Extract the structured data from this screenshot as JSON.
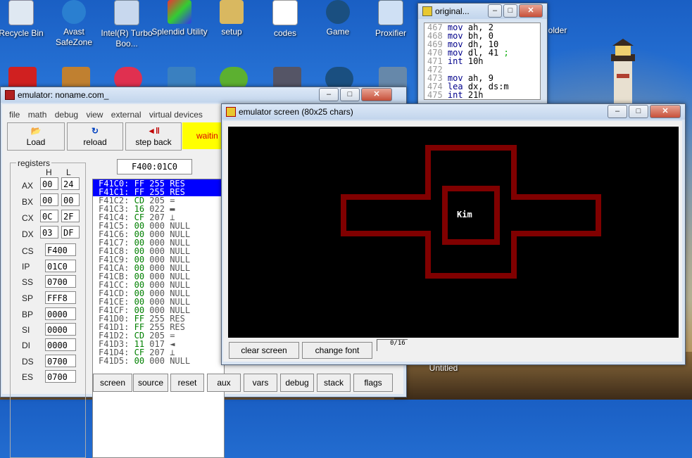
{
  "desktop": {
    "icons": [
      {
        "label": "Recycle Bin"
      },
      {
        "label": "Avast SafeZone"
      },
      {
        "label": "Intel(R) Turbo Boo..."
      },
      {
        "label": "Splendid Utility"
      },
      {
        "label": "setup"
      },
      {
        "label": "codes"
      },
      {
        "label": "Game"
      },
      {
        "label": "Proxifier"
      }
    ],
    "partial_label": "older",
    "untitled_label": "Untitled"
  },
  "source_window": {
    "title": "original...",
    "lines": [
      {
        "n": "467",
        "op": "mov",
        "args": "ah, 2",
        "comment": ""
      },
      {
        "n": "468",
        "op": "mov",
        "args": "bh, 0",
        "comment": ""
      },
      {
        "n": "469",
        "op": "mov",
        "args": "dh, 10",
        "comment": ""
      },
      {
        "n": "470",
        "op": "mov",
        "args": "dl, 41",
        "comment": ";"
      },
      {
        "n": "471",
        "op": "int",
        "args": "10h",
        "comment": ""
      },
      {
        "n": "472",
        "op": "",
        "args": "",
        "comment": ""
      },
      {
        "n": "473",
        "op": "mov",
        "args": "ah, 9",
        "comment": ""
      },
      {
        "n": "474",
        "op": "lea",
        "args": "dx, ds:m",
        "comment": ""
      },
      {
        "n": "475",
        "op": "int",
        "args": "21h",
        "comment": ""
      }
    ]
  },
  "emulator": {
    "title": "emulator: noname.com_",
    "menu": [
      "file",
      "math",
      "debug",
      "view",
      "external",
      "virtual devices"
    ],
    "toolbar": {
      "load": "Load",
      "reload": "reload",
      "step_back": "step back",
      "status": "waitin"
    },
    "registers_label": "registers",
    "h_label": "H",
    "l_label": "L",
    "regs8": [
      {
        "name": "AX",
        "h": "00",
        "l": "24"
      },
      {
        "name": "BX",
        "h": "00",
        "l": "00"
      },
      {
        "name": "CX",
        "h": "0C",
        "l": "2F"
      },
      {
        "name": "DX",
        "h": "03",
        "l": "DF"
      }
    ],
    "regs16": [
      {
        "name": "CS",
        "v": "F400"
      },
      {
        "name": "IP",
        "v": "01C0"
      },
      {
        "name": "SS",
        "v": "0700"
      },
      {
        "name": "SP",
        "v": "FFF8"
      },
      {
        "name": "BP",
        "v": "0000"
      },
      {
        "name": "SI",
        "v": "0000"
      },
      {
        "name": "DI",
        "v": "0000"
      },
      {
        "name": "DS",
        "v": "0700"
      },
      {
        "name": "ES",
        "v": "0700"
      }
    ],
    "address": "F400:01C0",
    "memory": [
      {
        "addr": "F41C0:",
        "hex": "FF",
        "dec": "255",
        "ch": "RES",
        "sel": true
      },
      {
        "addr": "F41C1:",
        "hex": "FF",
        "dec": "255",
        "ch": "RES",
        "sel": true
      },
      {
        "addr": "F41C2:",
        "hex": "CD",
        "dec": "205",
        "ch": "="
      },
      {
        "addr": "F41C3:",
        "hex": "16",
        "dec": "022",
        "ch": "▬"
      },
      {
        "addr": "F41C4:",
        "hex": "CF",
        "dec": "207",
        "ch": "⊥"
      },
      {
        "addr": "F41C5:",
        "hex": "00",
        "dec": "000",
        "ch": "NULL"
      },
      {
        "addr": "F41C6:",
        "hex": "00",
        "dec": "000",
        "ch": "NULL"
      },
      {
        "addr": "F41C7:",
        "hex": "00",
        "dec": "000",
        "ch": "NULL"
      },
      {
        "addr": "F41C8:",
        "hex": "00",
        "dec": "000",
        "ch": "NULL"
      },
      {
        "addr": "F41C9:",
        "hex": "00",
        "dec": "000",
        "ch": "NULL"
      },
      {
        "addr": "F41CA:",
        "hex": "00",
        "dec": "000",
        "ch": "NULL"
      },
      {
        "addr": "F41CB:",
        "hex": "00",
        "dec": "000",
        "ch": "NULL"
      },
      {
        "addr": "F41CC:",
        "hex": "00",
        "dec": "000",
        "ch": "NULL"
      },
      {
        "addr": "F41CD:",
        "hex": "00",
        "dec": "000",
        "ch": "NULL"
      },
      {
        "addr": "F41CE:",
        "hex": "00",
        "dec": "000",
        "ch": "NULL"
      },
      {
        "addr": "F41CF:",
        "hex": "00",
        "dec": "000",
        "ch": "NULL"
      },
      {
        "addr": "F41D0:",
        "hex": "FF",
        "dec": "255",
        "ch": "RES"
      },
      {
        "addr": "F41D1:",
        "hex": "FF",
        "dec": "255",
        "ch": "RES"
      },
      {
        "addr": "F41D2:",
        "hex": "CD",
        "dec": "205",
        "ch": "="
      },
      {
        "addr": "F41D3:",
        "hex": "11",
        "dec": "017",
        "ch": "◄"
      },
      {
        "addr": "F41D4:",
        "hex": "CF",
        "dec": "207",
        "ch": "⊥"
      },
      {
        "addr": "F41D5:",
        "hex": "00",
        "dec": "000",
        "ch": "NULL"
      }
    ],
    "bottom_buttons": [
      "screen",
      "source",
      "reset",
      "aux",
      "vars",
      "debug",
      "stack",
      "flags"
    ]
  },
  "screen_window": {
    "title": "emulator screen (80x25 chars)",
    "content_text": "Kim",
    "clear_label": "clear screen",
    "font_label": "change font",
    "pager": "0/16"
  },
  "colors": {
    "accent": "#0000ff",
    "shape": "#800000",
    "status": "#ffff00"
  }
}
